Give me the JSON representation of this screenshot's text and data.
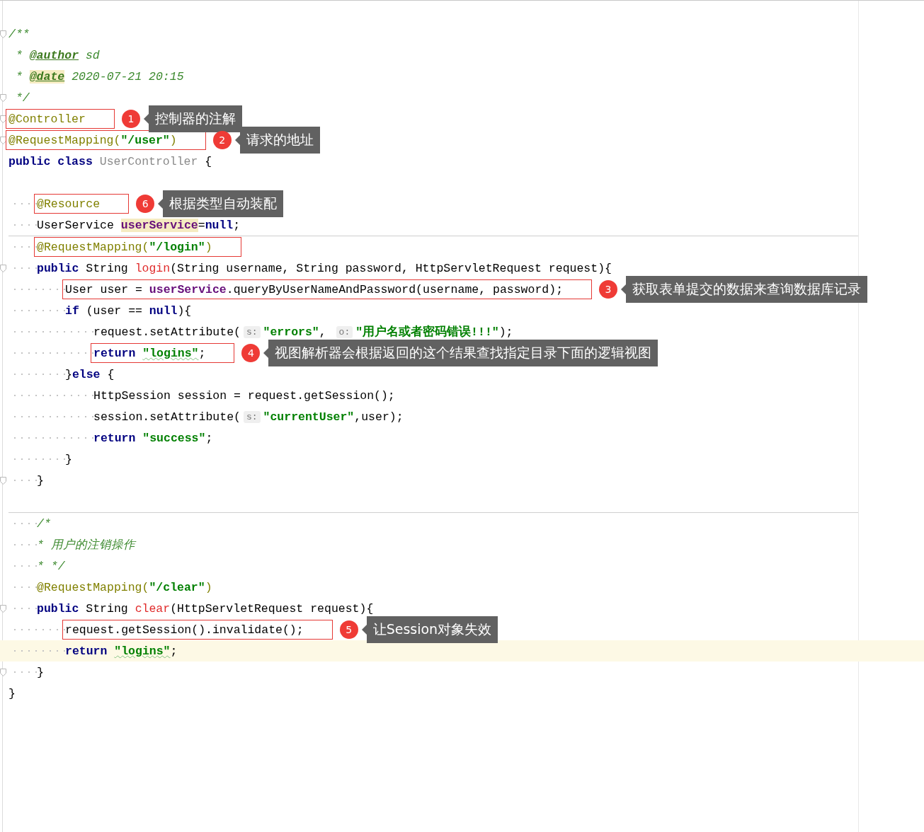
{
  "editor": {
    "lines": [
      {
        "fold": true,
        "tokens": [
          {
            "kind": "comment",
            "text": "/**"
          }
        ]
      },
      {
        "tokens": [
          {
            "kind": "comment",
            "text": " * "
          },
          {
            "kind": "doctag",
            "text": "@author"
          },
          {
            "kind": "comment",
            "text": " sd"
          }
        ]
      },
      {
        "tokens": [
          {
            "kind": "comment",
            "text": " * "
          },
          {
            "kind": "doctag",
            "text": "@date",
            "highlight": true
          },
          {
            "kind": "comment",
            "text": " 2020-07-21 20:15"
          }
        ]
      },
      {
        "fold": true,
        "tokens": [
          {
            "kind": "comment",
            "text": " */"
          }
        ]
      },
      {
        "fold": true,
        "boxed": true,
        "callout": {
          "number": "1",
          "text": "控制器的注解"
        },
        "tokens": [
          {
            "kind": "annotation",
            "text": "@Controller"
          }
        ]
      },
      {
        "fold": true,
        "boxed": true,
        "callout": {
          "number": "2",
          "text": "请求的地址"
        },
        "tokens": [
          {
            "kind": "annotation",
            "text": "@RequestMapping("
          },
          {
            "kind": "string",
            "text": "\"/user\""
          },
          {
            "kind": "annotation",
            "text": ")"
          }
        ]
      },
      {
        "tokens": [
          {
            "kind": "keyword",
            "text": "public class "
          },
          {
            "kind": "unused",
            "text": "UserController"
          },
          {
            "kind": "plain",
            "text": " {"
          }
        ],
        "children": [
          {
            "kind": "blank"
          },
          {
            "boxed": true,
            "callout": {
              "number": "6",
              "text": "根据类型自动装配"
            },
            "tokens": [
              {
                "kind": "annotation",
                "text": "@Resource"
              }
            ]
          },
          {
            "tokens": [
              {
                "kind": "plain",
                "text": "UserService "
              },
              {
                "kind": "field",
                "text": "userService",
                "highlight": true
              },
              {
                "kind": "plain",
                "text": "="
              },
              {
                "kind": "keyword",
                "text": "null"
              },
              {
                "kind": "plain",
                "text": ";"
              }
            ]
          },
          {
            "separator": true,
            "boxed": true,
            "tokens": [
              {
                "kind": "annotation",
                "text": "@RequestMapping("
              },
              {
                "kind": "string",
                "text": "\"/login\""
              },
              {
                "kind": "annotation",
                "text": ")"
              }
            ]
          },
          {
            "fold": true,
            "tokens": [
              {
                "kind": "keyword",
                "text": "public "
              },
              {
                "kind": "plain",
                "text": "String "
              },
              {
                "kind": "method",
                "text": "login"
              },
              {
                "kind": "plain",
                "text": "(String username, String password, HttpServletRequest request){"
              }
            ],
            "children": [
              {
                "boxed": true,
                "callout": {
                  "number": "3",
                  "text": "获取表单提交的数据来查询数据库记录"
                },
                "tokens": [
                  {
                    "kind": "plain",
                    "text": "User user = "
                  },
                  {
                    "kind": "field",
                    "text": "userService"
                  },
                  {
                    "kind": "plain",
                    "text": ".queryByUserNameAndPassword(username, password);"
                  }
                ]
              },
              {
                "tokens": [
                  {
                    "kind": "keyword",
                    "text": "if "
                  },
                  {
                    "kind": "plain",
                    "text": "(user == "
                  },
                  {
                    "kind": "keyword",
                    "text": "null"
                  },
                  {
                    "kind": "plain",
                    "text": "){"
                  }
                ],
                "children": [
                  {
                    "tokens": [
                      {
                        "kind": "plain",
                        "text": "request.setAttribute("
                      },
                      {
                        "kind": "hint",
                        "text": "s:"
                      },
                      {
                        "kind": "string",
                        "text": "\"errors\""
                      },
                      {
                        "kind": "plain",
                        "text": ", "
                      },
                      {
                        "kind": "hint",
                        "text": "o:"
                      },
                      {
                        "kind": "string",
                        "text": "\"用户名或者密码错误!!!\""
                      },
                      {
                        "kind": "plain",
                        "text": ");"
                      }
                    ]
                  },
                  {
                    "boxed": true,
                    "callout": {
                      "number": "4",
                      "text": "视图解析器会根据返回的这个结果查找指定目录下面的逻辑视图"
                    },
                    "tokens": [
                      {
                        "kind": "keyword",
                        "text": "return "
                      },
                      {
                        "kind": "string",
                        "text": "\"logins\"",
                        "typo": true
                      },
                      {
                        "kind": "plain",
                        "text": ";"
                      }
                    ]
                  }
                ]
              },
              {
                "tokens": [
                  {
                    "kind": "plain",
                    "text": "}"
                  },
                  {
                    "kind": "keyword",
                    "text": "else"
                  },
                  {
                    "kind": "plain",
                    "text": " {"
                  }
                ],
                "children": [
                  {
                    "tokens": [
                      {
                        "kind": "plain",
                        "text": "HttpSession session = request.getSession();"
                      }
                    ]
                  },
                  {
                    "tokens": [
                      {
                        "kind": "plain",
                        "text": "session.setAttribute("
                      },
                      {
                        "kind": "hint",
                        "text": "s:"
                      },
                      {
                        "kind": "string",
                        "text": "\"currentUser\""
                      },
                      {
                        "kind": "plain",
                        "text": ",user);"
                      }
                    ]
                  },
                  {
                    "tokens": [
                      {
                        "kind": "keyword",
                        "text": "return "
                      },
                      {
                        "kind": "string",
                        "text": "\"success\""
                      },
                      {
                        "kind": "plain",
                        "text": ";"
                      }
                    ]
                  }
                ]
              },
              {
                "tokens": [
                  {
                    "kind": "plain",
                    "text": "}"
                  }
                ]
              }
            ]
          },
          {
            "fold": true,
            "tokens": [
              {
                "kind": "plain",
                "text": "}"
              }
            ]
          },
          {
            "kind": "blank"
          },
          {
            "separator": true,
            "tokens": [
              {
                "kind": "comment",
                "text": "/*"
              }
            ]
          },
          {
            "tokens": [
              {
                "kind": "comment",
                "text": "* 用户的注销操作"
              }
            ]
          },
          {
            "tokens": [
              {
                "kind": "comment",
                "text": "* */"
              }
            ]
          },
          {
            "tokens": [
              {
                "kind": "annotation",
                "text": "@RequestMapping("
              },
              {
                "kind": "string",
                "text": "\"/clear\""
              },
              {
                "kind": "annotation",
                "text": ")"
              }
            ]
          },
          {
            "fold": true,
            "tokens": [
              {
                "kind": "keyword",
                "text": "public "
              },
              {
                "kind": "plain",
                "text": "String "
              },
              {
                "kind": "method",
                "text": "clear"
              },
              {
                "kind": "plain",
                "text": "(HttpServletRequest request){"
              }
            ],
            "children": [
              {
                "boxed": true,
                "callout": {
                  "number": "5",
                  "text": "让Session对象失效"
                },
                "tokens": [
                  {
                    "kind": "plain",
                    "text": "request.getSession().invalidate();"
                  }
                ]
              },
              {
                "current": true,
                "tokens": [
                  {
                    "kind": "keyword",
                    "text": "return "
                  },
                  {
                    "kind": "string",
                    "text": "\"logins\"",
                    "typo": true
                  },
                  {
                    "kind": "plain",
                    "text": ";"
                  }
                ]
              }
            ]
          },
          {
            "fold": true,
            "tokens": [
              {
                "kind": "plain",
                "text": "}"
              }
            ]
          }
        ]
      },
      {
        "tokens": [
          {
            "kind": "plain",
            "text": "}"
          }
        ]
      }
    ]
  }
}
